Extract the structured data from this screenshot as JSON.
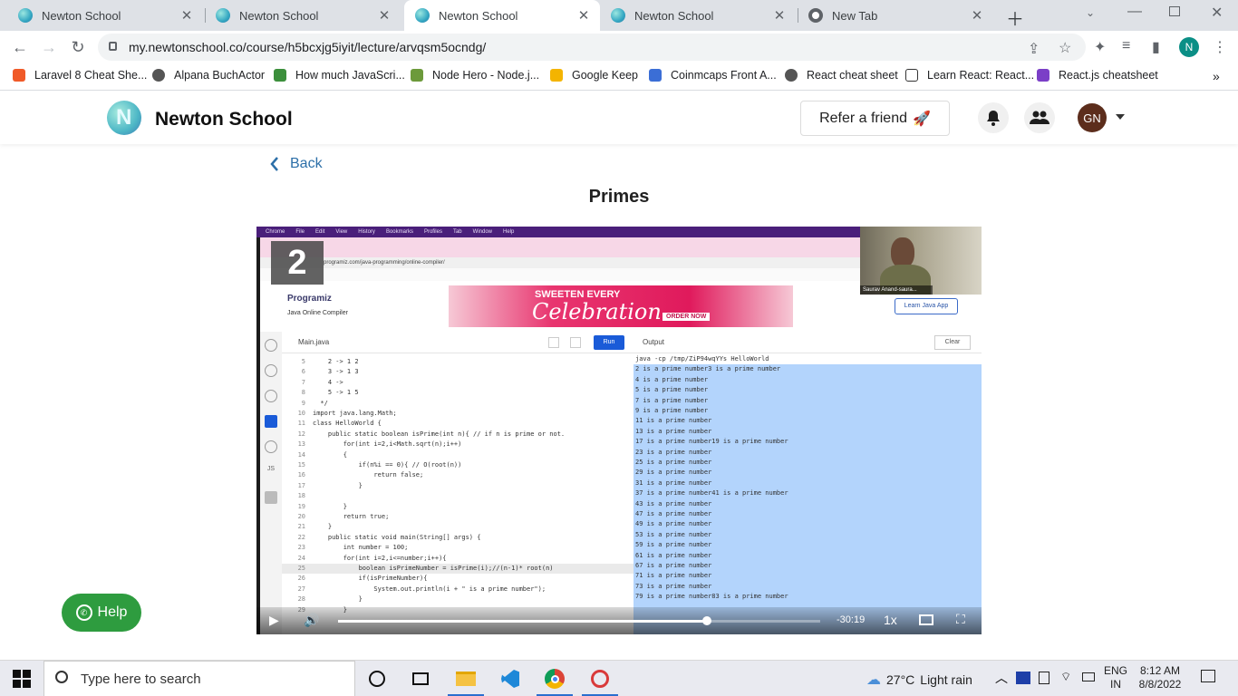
{
  "browser": {
    "tabs": [
      {
        "title": "Newton School",
        "icon": "newton-favicon"
      },
      {
        "title": "Newton School",
        "icon": "newton-favicon"
      },
      {
        "title": "Newton School",
        "icon": "newton-favicon",
        "active": true
      },
      {
        "title": "Newton School",
        "icon": "newton-favicon"
      },
      {
        "title": "New Tab",
        "icon": "chrome-icon"
      }
    ],
    "url": "my.newtonschool.co/course/h5bcxjg5iyit/lecture/arvqsm5ocndg/",
    "profile_initial": "N",
    "bookmarks": [
      "Laravel 8 Cheat She...",
      "Alpana BuchActor",
      "How much JavaScri...",
      "Node Hero - Node.j...",
      "Google Keep",
      "Coinmcaps Front A...",
      "React cheat sheet",
      "Learn React: React...",
      "React.js cheatsheet"
    ]
  },
  "site": {
    "brand": "Newton School",
    "refer_label": "Refer a friend",
    "avatar_initials": "GN",
    "back_label": "Back",
    "page_title": "Primes",
    "help_label": "Help"
  },
  "video": {
    "slide_number": "2",
    "presenter_name": "Saurav Anand-saura...",
    "mac_menu": [
      "Chrome",
      "File",
      "Edit",
      "View",
      "History",
      "Bookmarks",
      "Profiles",
      "Tab",
      "Window",
      "Help"
    ],
    "inner_url": "programiz.com/java-programming/online-compiler/",
    "programiz_logo": "Programiz",
    "programiz_subtitle": "Java Online Compiler",
    "ad_line1": "SWEETEN EVERY",
    "ad_line2": "Celebration",
    "ad_button": "ORDER NOW",
    "learn_button": "Learn Java App",
    "file_tab": "Main.java",
    "run_label": "Run",
    "output_label": "Output",
    "clear_label": "Clear",
    "code_lines": [
      {
        "n": "5",
        "t": "    2 -> 1 2"
      },
      {
        "n": "6",
        "t": "    3 -> 1 3"
      },
      {
        "n": "7",
        "t": "    4 ->"
      },
      {
        "n": "8",
        "t": "    5 -> 1 5"
      },
      {
        "n": "9",
        "t": "  */"
      },
      {
        "n": "10",
        "t": "import java.lang.Math;"
      },
      {
        "n": "11",
        "t": "class HelloWorld {"
      },
      {
        "n": "12",
        "t": "    public static boolean isPrime(int n){ // if n is prime or not."
      },
      {
        "n": "13",
        "t": "        for(int i=2,i<Math.sqrt(n);i++)"
      },
      {
        "n": "14",
        "t": "        {"
      },
      {
        "n": "15",
        "t": "            if(n%i == 0){ // O(root(n))"
      },
      {
        "n": "16",
        "t": "                return false;"
      },
      {
        "n": "17",
        "t": "            }"
      },
      {
        "n": "18",
        "t": ""
      },
      {
        "n": "19",
        "t": "        }"
      },
      {
        "n": "20",
        "t": "        return true;"
      },
      {
        "n": "21",
        "t": "    }"
      },
      {
        "n": "22",
        "t": "    public static void main(String[] args) {"
      },
      {
        "n": "23",
        "t": "        int number = 100;"
      },
      {
        "n": "24",
        "t": "        for(int i=2,i<=number;i++){"
      },
      {
        "n": "25",
        "t": "            boolean isPrimeNumber = isPrime(i);//(n-1)* root(n)",
        "hl": true
      },
      {
        "n": "26",
        "t": "            if(isPrimeNumber){"
      },
      {
        "n": "27",
        "t": "                System.out.println(i + \" is a prime number\");"
      },
      {
        "n": "28",
        "t": "            }"
      },
      {
        "n": "29",
        "t": "        }"
      }
    ],
    "output_lines": [
      "java -cp /tmp/ZiP94wqYYs HelloWorld",
      "2 is a prime number3 is a prime number",
      "4 is a prime number",
      "5 is a prime number",
      "7 is a prime number",
      "9 is a prime number",
      "11 is a prime number",
      "13 is a prime number",
      "17 is a prime number19 is a prime number",
      "23 is a prime number",
      "25 is a prime number",
      "29 is a prime number",
      "31 is a prime number",
      "37 is a prime number41 is a prime number",
      "43 is a prime number",
      "47 is a prime number",
      "49 is a prime number",
      "53 is a prime number",
      "59 is a prime number",
      "61 is a prime number",
      "67 is a prime number",
      "71 is a prime number",
      "73 is a prime number",
      "79 is a prime number83 is a prime number"
    ],
    "time_remaining": "-30:19",
    "speed": "1x",
    "progress_fraction": 0.765
  },
  "taskbar": {
    "search_placeholder": "Type here to search",
    "temperature": "27°C",
    "weather": "Light rain",
    "lang1": "ENG",
    "lang2": "IN",
    "time": "8:12 AM",
    "date": "8/8/2022"
  }
}
